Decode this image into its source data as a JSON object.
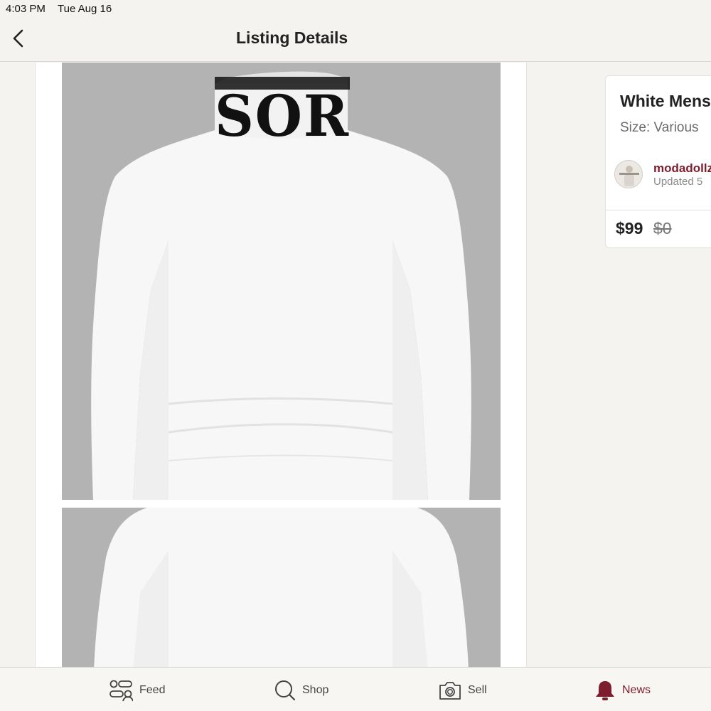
{
  "status_bar": {
    "time": "4:03 PM",
    "date": "Tue Aug 16"
  },
  "header": {
    "title": "Listing Details",
    "back_icon": "chevron-left-icon"
  },
  "gallery": {
    "photo_background": "#b3b3b3",
    "photos": [
      {
        "alt": "White turtleneck sweater with black lettering on collar"
      },
      {
        "alt": "White turtleneck sweater close-up"
      }
    ],
    "collar_text": "SOR"
  },
  "listing": {
    "title": "White Mens",
    "size_label": "Size:",
    "size_value": "Various",
    "seller": {
      "name": "modadollz",
      "updated": "Updated 5"
    },
    "price": "$99",
    "original_price": "$0"
  },
  "tab_bar": {
    "active_color": "#7d1d2e",
    "items": [
      {
        "label": "Feed",
        "icon": "feed-icon"
      },
      {
        "label": "Shop",
        "icon": "search-icon"
      },
      {
        "label": "Sell",
        "icon": "camera-icon"
      },
      {
        "label": "News",
        "icon": "bell-icon"
      }
    ]
  }
}
